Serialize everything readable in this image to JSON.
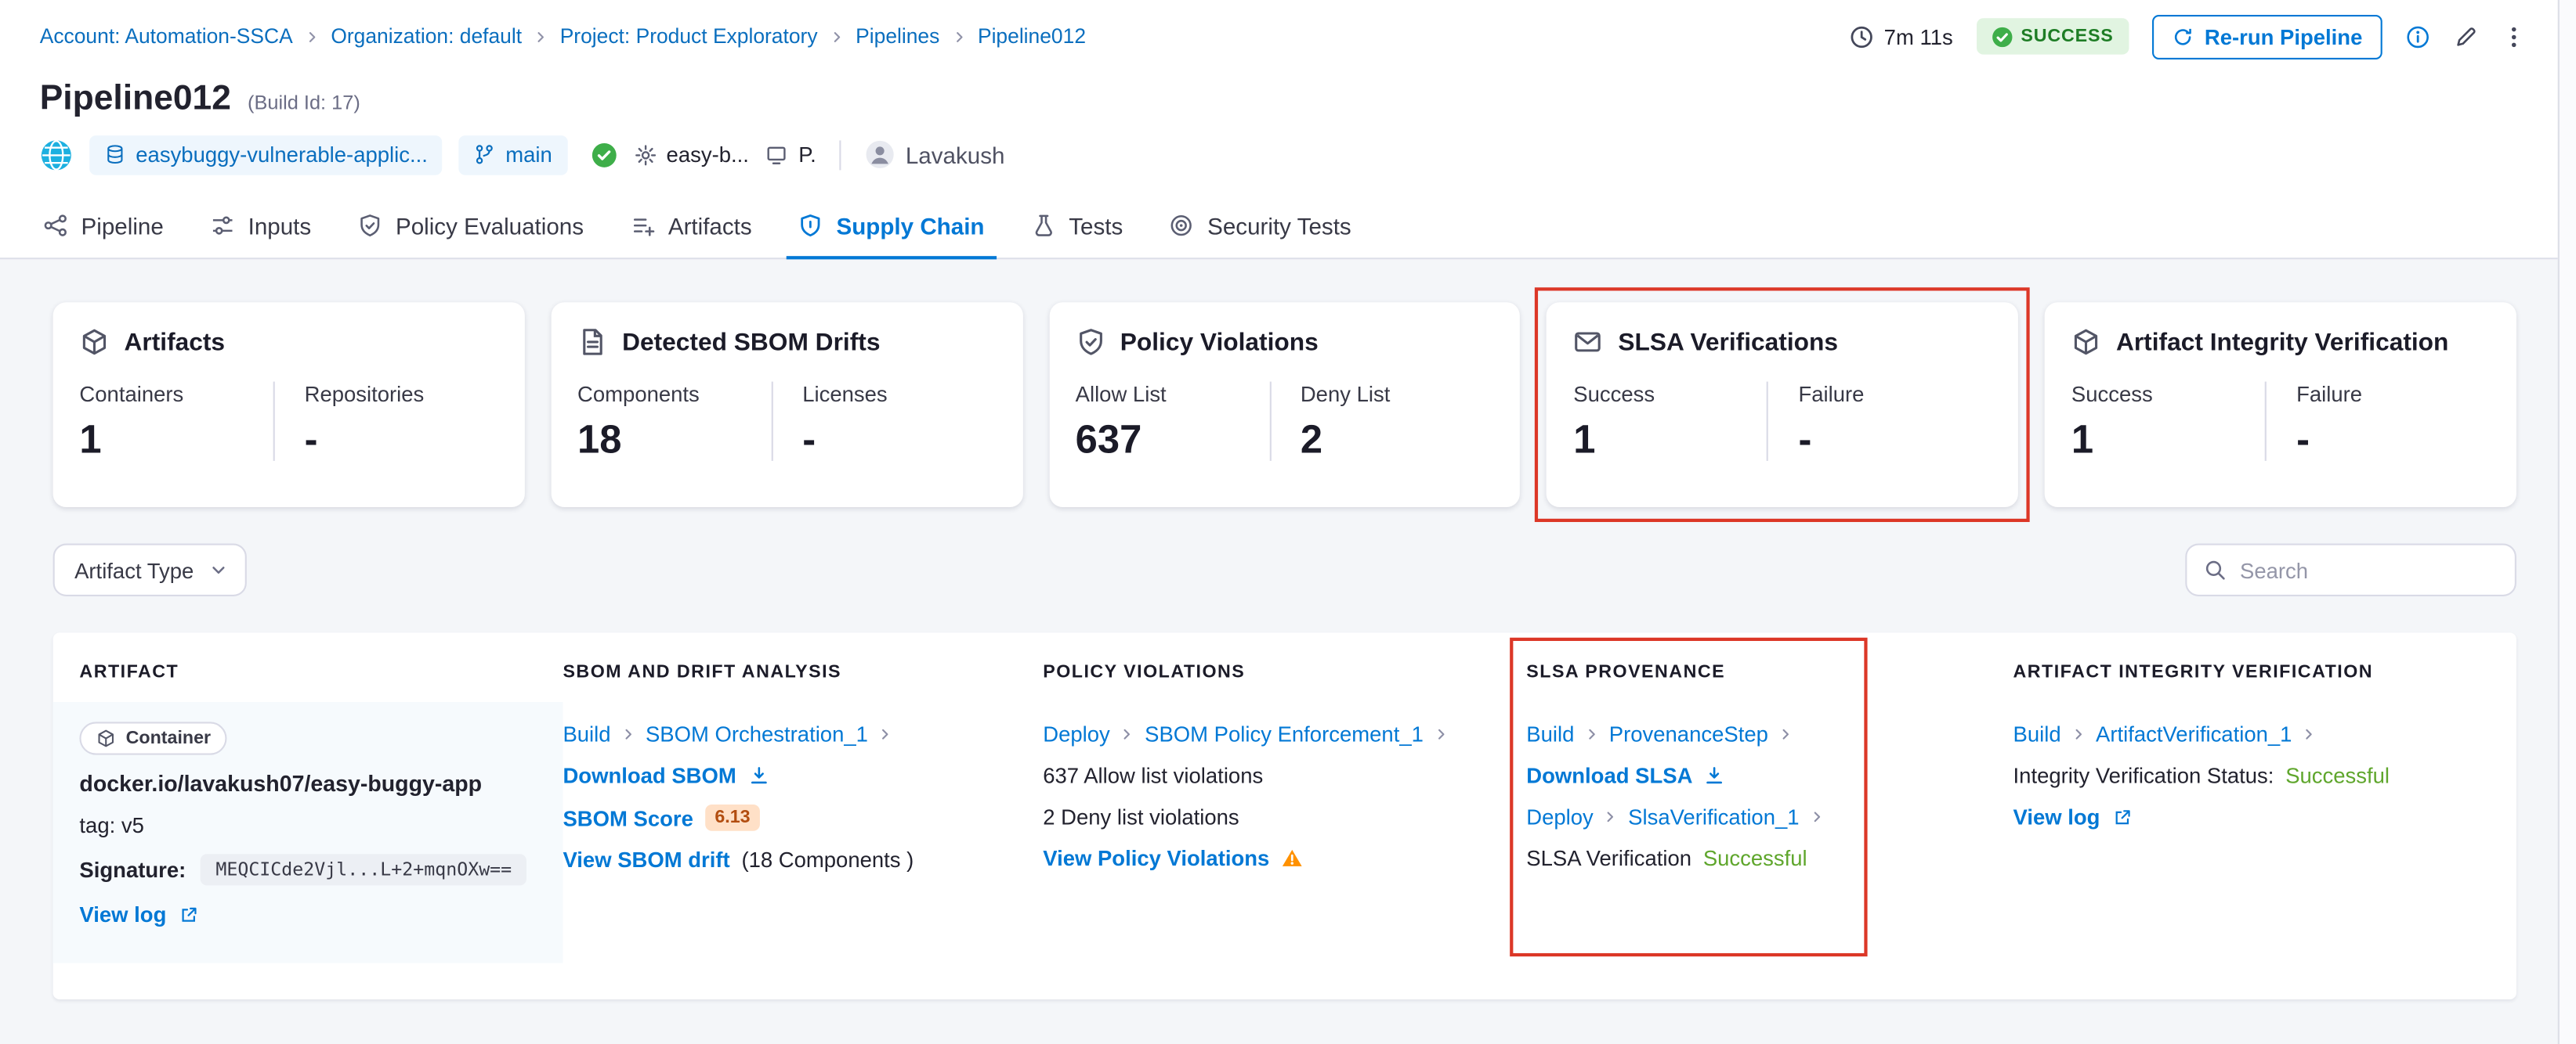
{
  "colors": {
    "accent_blue": "#0278d5",
    "annotation_red": "#dc3727",
    "success_badge_green": "#1e7d25",
    "success_text_green": "#5fa62c",
    "warning_orange": "#ff9100",
    "score_badge_bg": "#ffe0c7",
    "score_badge_text": "#b24d10"
  },
  "breadcrumb": {
    "items": [
      {
        "label": "Account: Automation-SSCA"
      },
      {
        "label": "Organization: default"
      },
      {
        "label": "Project: Product Exploratory"
      },
      {
        "label": "Pipelines"
      },
      {
        "label": "Pipeline012"
      }
    ]
  },
  "topbar": {
    "duration": "7m 11s",
    "status_badge": "SUCCESS",
    "rerun_button": "Re-run Pipeline"
  },
  "header": {
    "title": "Pipeline012",
    "build_id": "(Build Id: 17)",
    "repo": "easybuggy-vulnerable-applic...",
    "branch": "main",
    "service": "easy-b...",
    "environment": "P.",
    "user": "Lavakush"
  },
  "tabs": [
    {
      "label": "Pipeline"
    },
    {
      "label": "Inputs"
    },
    {
      "label": "Policy Evaluations"
    },
    {
      "label": "Artifacts"
    },
    {
      "label": "Supply Chain"
    },
    {
      "label": "Tests"
    },
    {
      "label": "Security Tests"
    }
  ],
  "summary_cards": [
    {
      "title": "Artifacts",
      "metrics": [
        {
          "label": "Containers",
          "value": "1"
        },
        {
          "label": "Repositories",
          "value": "-"
        }
      ]
    },
    {
      "title": "Detected SBOM Drifts",
      "metrics": [
        {
          "label": "Components",
          "value": "18"
        },
        {
          "label": "Licenses",
          "value": "-"
        }
      ]
    },
    {
      "title": "Policy Violations",
      "metrics": [
        {
          "label": "Allow List",
          "value": "637"
        },
        {
          "label": "Deny List",
          "value": "2"
        }
      ]
    },
    {
      "title": "SLSA Verifications",
      "metrics": [
        {
          "label": "Success",
          "value": "1"
        },
        {
          "label": "Failure",
          "value": "-"
        }
      ]
    },
    {
      "title": "Artifact Integrity Verification",
      "metrics": [
        {
          "label": "Success",
          "value": "1"
        },
        {
          "label": "Failure",
          "value": "-"
        }
      ]
    }
  ],
  "filters": {
    "artifact_type": "Artifact Type",
    "search_placeholder": "Search"
  },
  "table": {
    "headers": [
      "ARTIFACT",
      "SBOM AND DRIFT ANALYSIS",
      "POLICY VIOLATIONS",
      "SLSA PROVENANCE",
      "ARTIFACT INTEGRITY VERIFICATION"
    ],
    "row": {
      "artifact": {
        "type": "Container",
        "name": "docker.io/lavakush07/easy-buggy-app",
        "tag": "tag: v5",
        "signature_label": "Signature:",
        "signature": "MEQCICde2Vjl...L+2+mqnOXw==",
        "view_log": "View log"
      },
      "sbom": {
        "stage": "Build",
        "step": "SBOM Orchestration_1",
        "download": "Download SBOM",
        "score_label": "SBOM Score",
        "score": "6.13",
        "drift_link": "View SBOM drift",
        "drift_note": "(18 Components )"
      },
      "policy": {
        "stage": "Deploy",
        "step": "SBOM Policy Enforcement_1",
        "allow": "637 Allow list violations",
        "deny": "2 Deny list violations",
        "view": "View Policy Violations"
      },
      "slsa": {
        "stage1": "Build",
        "step1": "ProvenanceStep",
        "download": "Download SLSA",
        "stage2": "Deploy",
        "step2": "SlsaVerification_1",
        "status_label": "SLSA Verification",
        "status": "Successful"
      },
      "integrity": {
        "stage": "Build",
        "step": "ArtifactVerification_1",
        "status_label": "Integrity Verification Status:",
        "status": "Successful",
        "view_log": "View log"
      }
    }
  }
}
